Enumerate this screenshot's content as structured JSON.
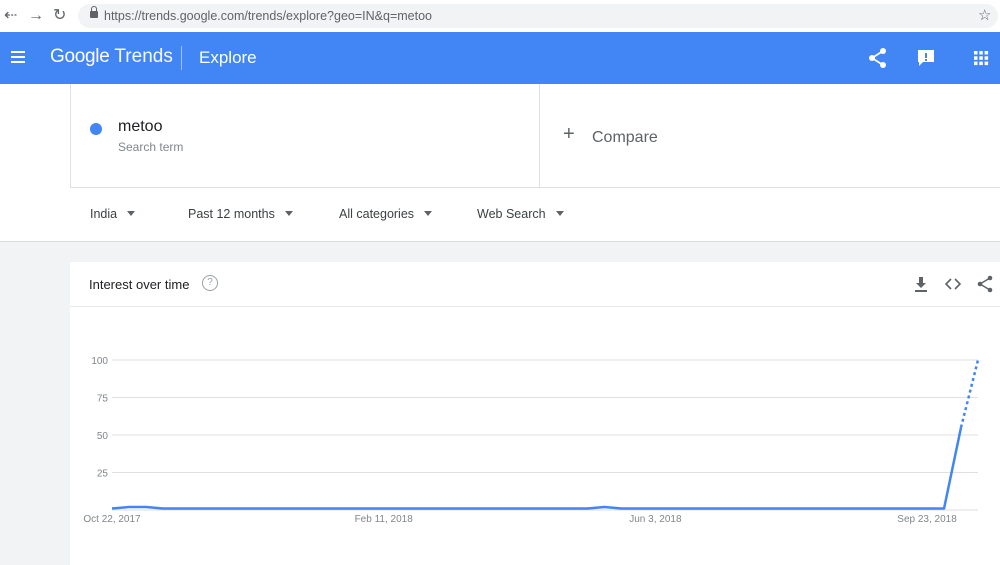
{
  "browser": {
    "url": "https://trends.google.com/trends/explore?geo=IN&q=metoo"
  },
  "header": {
    "logo_google": "Google",
    "logo_trends": "Trends",
    "title": "Explore",
    "color": "#4285f4"
  },
  "search_term": {
    "term": "metoo",
    "subtitle": "Search term",
    "color": "#4285f4"
  },
  "compare": {
    "label": "Compare"
  },
  "filters": {
    "region": "India",
    "time": "Past 12 months",
    "category": "All categories",
    "property": "Web Search"
  },
  "chart_card": {
    "title": "Interest over time",
    "help_glyph": "?"
  },
  "chart_data": {
    "type": "line",
    "title": "Interest over time",
    "xlabel": "",
    "ylabel": "",
    "ylim": [
      0,
      100
    ],
    "y_ticks": [
      25,
      50,
      75,
      100
    ],
    "x_tick_labels": [
      "Oct 22, 2017",
      "Feb 11, 2018",
      "Jun 3, 2018",
      "Sep 23, 2018"
    ],
    "x_tick_week_index": [
      0,
      16,
      32,
      48
    ],
    "series": [
      {
        "color": "#4285f4",
        "week_index": [
          0,
          1,
          2,
          3,
          5,
          10,
          15,
          20,
          25,
          28,
          29,
          30,
          31,
          35,
          40,
          45,
          48,
          49,
          50,
          51
        ],
        "values": [
          1,
          2,
          2,
          1,
          1,
          1,
          1,
          1,
          1,
          1,
          2,
          1,
          1,
          1,
          1,
          1,
          1,
          1,
          55,
          100
        ],
        "partial_from_week_index": 50
      }
    ],
    "grid": true
  }
}
